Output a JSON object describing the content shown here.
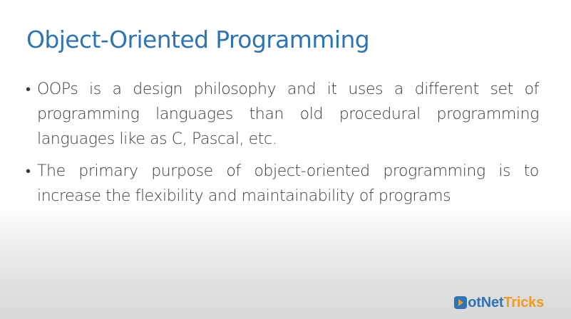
{
  "slide": {
    "title": "Object-Oriented Programming",
    "bullets": [
      {
        "marker": "•",
        "text": "OOPs is a design philosophy and it uses a different set of programming languages than old procedural programming languages like as C, Pascal, etc."
      },
      {
        "marker": "•",
        "text": "The primary purpose of object-oriented programming is to increase the flexibility and maintainability of programs"
      }
    ]
  },
  "logo": {
    "part1": "otNet",
    "part2": "Tricks",
    "icon": "play-d-icon",
    "colors": {
      "primary": "#2e74b5",
      "accent": "#f39a1e"
    }
  },
  "theme": {
    "title_color": "#2e74b5",
    "text_color": "#3a3a3a"
  }
}
